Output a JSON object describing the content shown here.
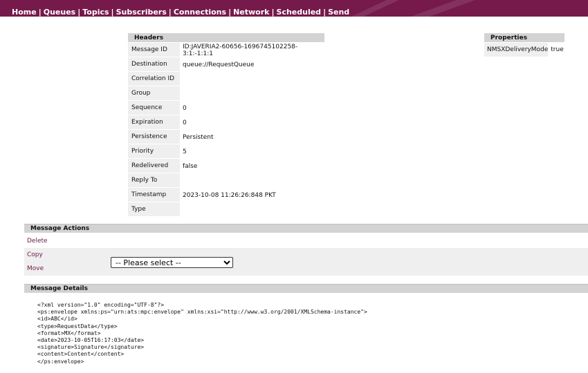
{
  "nav": [
    "Home",
    "Queues",
    "Topics",
    "Subscribers",
    "Connections",
    "Network",
    "Scheduled",
    "Send"
  ],
  "nav_separator": "|",
  "headers": {
    "title": "Headers",
    "rows": [
      {
        "key": "Message ID",
        "value": "ID:JAVERIA2-60656-1696745102258-3:1:-1:1:1"
      },
      {
        "key": "Destination",
        "value": "queue://RequestQueue"
      },
      {
        "key": "Correlation ID",
        "value": ""
      },
      {
        "key": "Group",
        "value": ""
      },
      {
        "key": "Sequence",
        "value": "0"
      },
      {
        "key": "Expiration",
        "value": "0"
      },
      {
        "key": "Persistence",
        "value": "Persistent"
      },
      {
        "key": "Priority",
        "value": "5"
      },
      {
        "key": "Redelivered",
        "value": "false"
      },
      {
        "key": "Reply To",
        "value": ""
      },
      {
        "key": "Timestamp",
        "value": "2023-10-08 11:26:26:848 PKT"
      },
      {
        "key": "Type",
        "value": ""
      }
    ]
  },
  "properties": {
    "title": "Properties",
    "rows": [
      {
        "key": "NMSXDeliveryMode",
        "value": "true"
      }
    ]
  },
  "actions": {
    "title": "Message Actions",
    "delete": "Delete",
    "copy": "Copy",
    "move": "Move",
    "select_placeholder": "-- Please select --"
  },
  "details": {
    "title": "Message Details",
    "lines": [
      "<?xml version=\"1.0\" encoding=\"UTF-8\"?>",
      "<ps:envelope xmlns:ps=\"urn:ats:mpc:envelope\" xmlns:xsi=\"http://www.w3.org/2001/XMLSchema-instance\">",
      "<id>ABC</id>",
      "<type>RequestData</type>",
      "<format>MX</format>",
      "<date>2023-10-05T16:17:03</date>",
      "<signature>Signature</signature>",
      "<content>Content</content>",
      "</ps:envelope>"
    ]
  }
}
